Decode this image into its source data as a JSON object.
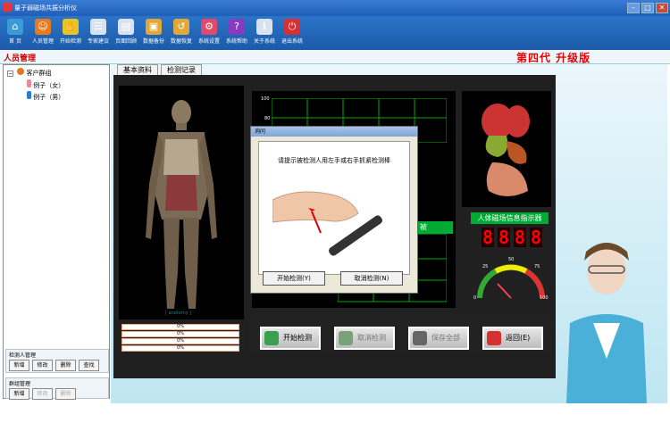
{
  "window": {
    "title": "量子弱磁场共振分析仪",
    "min": "–",
    "max": "□",
    "close": "✕"
  },
  "toolbar": {
    "items": [
      {
        "label": "首 页",
        "icon": "home-icon",
        "color": "#3b9bd8"
      },
      {
        "label": "人员管理",
        "icon": "users-icon",
        "color": "#e87a20"
      },
      {
        "label": "开始检测",
        "icon": "hand-icon",
        "color": "#e7c52a"
      },
      {
        "label": "专家建议",
        "icon": "clipboard-icon",
        "color": "#d8e3ef"
      },
      {
        "label": "页面回顾",
        "icon": "document-icon",
        "color": "#d8e3ef"
      },
      {
        "label": "数据备份",
        "icon": "backup-icon",
        "color": "#e0a73a"
      },
      {
        "label": "数据恢复",
        "icon": "restore-icon",
        "color": "#e0a73a"
      },
      {
        "label": "系统设置",
        "icon": "settings-icon",
        "color": "#e04a6a"
      },
      {
        "label": "系统帮助",
        "icon": "help-icon",
        "color": "#8a3ac0"
      },
      {
        "label": "关于系统",
        "icon": "about-icon",
        "color": "#d8e3ef"
      },
      {
        "label": "退出系统",
        "icon": "exit-icon",
        "color": "#d83030"
      }
    ]
  },
  "header": {
    "page_title": "人员管理",
    "edition": "第四代 升级版"
  },
  "tree": {
    "root": "客户群组",
    "items": [
      "例子（女）",
      "例子（男）"
    ]
  },
  "tested_group": {
    "title": "检测人管理",
    "buttons": [
      "新增",
      "修改",
      "删除",
      "查找"
    ]
  },
  "group_mgmt": {
    "title": "群组管理",
    "buttons": [
      "新增",
      "修改",
      "删除"
    ]
  },
  "tabs": [
    "基本资料",
    "检测记录"
  ],
  "chart": {
    "ticks": [
      "100",
      "80"
    ],
    "label": "被"
  },
  "bars": [
    "0%",
    "0%",
    "0%",
    "0%"
  ],
  "magnet": {
    "title": "人体磁场信息指示器",
    "digits": "8888",
    "gauge_labels": [
      "0",
      "25",
      "50",
      "75",
      "100"
    ]
  },
  "actions": [
    {
      "label": "开始检测",
      "color": "#3aa050",
      "enabled": true
    },
    {
      "label": "取消检测",
      "color": "#7aa27a",
      "enabled": false
    },
    {
      "label": "保存全部",
      "color": "#666666",
      "enabled": false
    },
    {
      "label": "返回(E)",
      "color": "#d83030",
      "enabled": true
    }
  ],
  "dialog": {
    "title": "询问",
    "message": "请提示被检测人用左手或右手抓紧检测棒",
    "ok": "开始检测(Y)",
    "cancel": "取消检测(N)"
  },
  "axis_caption": "[ anatomy ]"
}
